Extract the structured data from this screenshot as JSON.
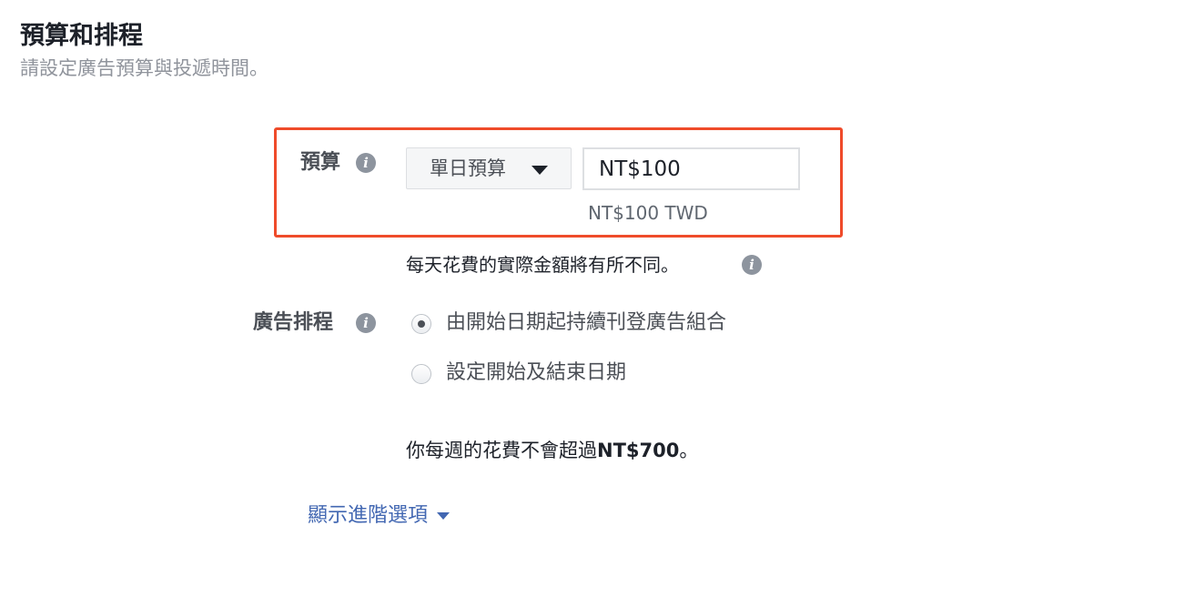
{
  "section": {
    "title": "預算和排程",
    "subtitle": "請設定廣告預算與投遞時間。"
  },
  "budget": {
    "label": "預算",
    "type_selected": "單日預算",
    "amount_value": "NT$100",
    "currency_note": "NT$100 TWD",
    "daily_spend_note": "每天花費的實際金額將有所不同。"
  },
  "schedule": {
    "label": "廣告排程",
    "options": [
      {
        "label": "由開始日期起持續刊登廣告組合",
        "selected": true
      },
      {
        "label": "設定開始及結束日期",
        "selected": false
      }
    ]
  },
  "weekly_note": {
    "prefix": "你每週的花費不會超過",
    "amount": "NT$700",
    "suffix": "。"
  },
  "advanced_options_label": "顯示進階選項",
  "colors": {
    "highlight_border": "#ef4b2a",
    "link": "#4267b2"
  },
  "icons": {
    "info": "info-icon",
    "dropdown": "caret-down-icon"
  }
}
